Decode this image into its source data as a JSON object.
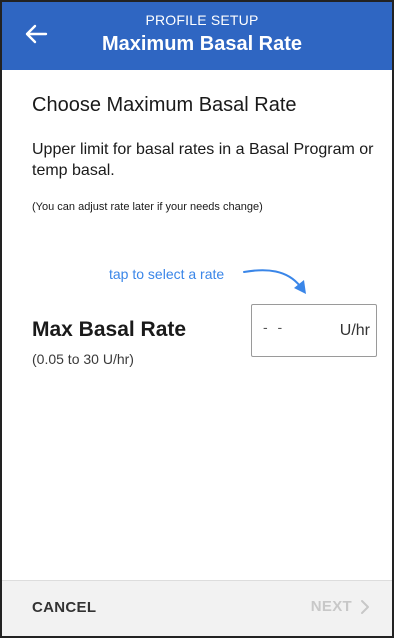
{
  "header": {
    "subtitle": "PROFILE SETUP",
    "title": "Maximum Basal Rate",
    "back_icon": "arrow-left-icon",
    "background": "#2f66c2"
  },
  "main": {
    "heading": "Choose Maximum Basal Rate",
    "description": "Upper limit for basal rates in a Basal Program or temp basal.",
    "note": "(You can adjust rate later if your needs change)",
    "hint": "tap to select a rate",
    "hint_color": "#3a86e8"
  },
  "field": {
    "label": "Max Basal Rate",
    "range": "(0.05 to 30 U/hr)",
    "value": "- -",
    "unit": "U/hr"
  },
  "footer": {
    "cancel_label": "CANCEL",
    "next_label": "NEXT",
    "next_enabled": false,
    "next_icon": "chevron-right-icon"
  }
}
